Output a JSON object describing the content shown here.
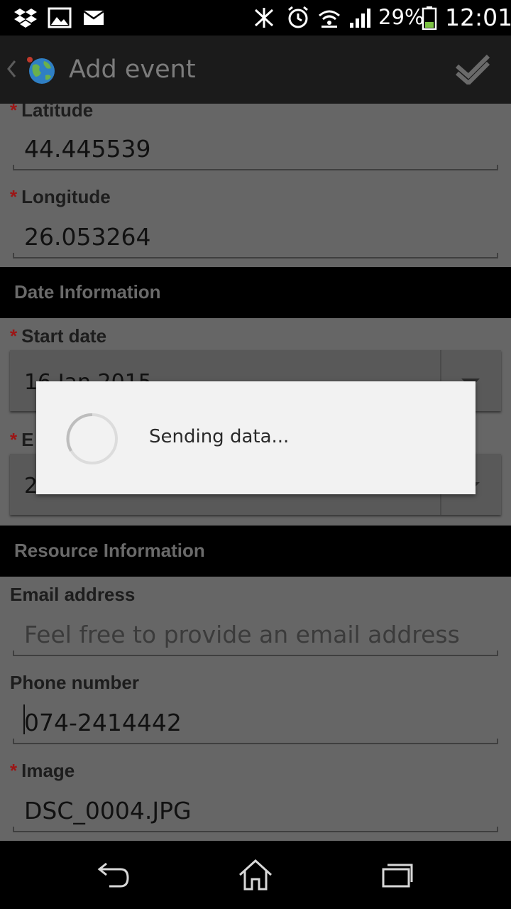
{
  "status_bar": {
    "icons": [
      "dropbox-icon",
      "gallery-icon",
      "mail-icon",
      "bluetooth-icon",
      "alarm-icon",
      "wifi-icon",
      "signal-icon",
      "battery-icon"
    ],
    "battery_percent": "29%",
    "time": "12:01"
  },
  "action_bar": {
    "title": "Add event",
    "back_icon": "chevron-left-icon",
    "app_icon": "globe-icon",
    "confirm_icon": "done-icon"
  },
  "form": {
    "latitude": {
      "label": "Latitude",
      "value": "44.445539"
    },
    "longitude": {
      "label": "Longitude",
      "value": "26.053264"
    },
    "date_section": "Date Information",
    "start_date": {
      "label": "Start date",
      "value": "16 Jan 2015"
    },
    "end_date": {
      "label": "E",
      "value": "2"
    },
    "resource_section": "Resource Information",
    "email": {
      "label": "Email address",
      "placeholder": "Feel free to provide an email address"
    },
    "phone": {
      "label": "Phone number",
      "value": "074-2414442"
    },
    "image": {
      "label": "Image",
      "value": "DSC_0004.JPG"
    },
    "required_marker": "*"
  },
  "dialog": {
    "message": "Sending data..."
  },
  "nav_bar": {
    "icons": [
      "back-icon",
      "home-icon",
      "recent-apps-icon"
    ]
  }
}
